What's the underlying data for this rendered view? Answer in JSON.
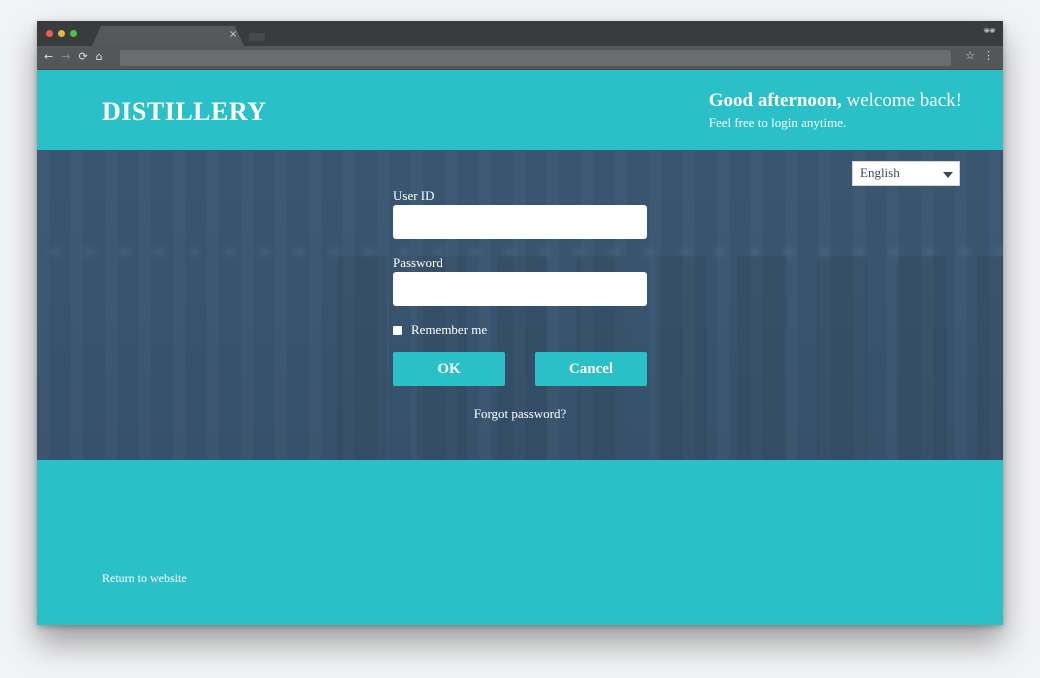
{
  "browser": {
    "tab_close": "×",
    "incognito_icon": "🕶",
    "nav_back": "←",
    "nav_forward": "→",
    "nav_reload": "⟳",
    "nav_home": "⌂",
    "star_icon": "☆",
    "menu_icon": "⋮"
  },
  "header": {
    "logo": "DISTILLERY",
    "greeting_bold": "Good afternoon,",
    "greeting_rest": " welcome back!",
    "greeting_sub": "Feel free to login anytime."
  },
  "language": {
    "selected": "English"
  },
  "login": {
    "user_id_label": "User ID",
    "user_id_value": "",
    "password_label": "Password",
    "password_value": "",
    "remember_label": "Remember me",
    "ok_label": "OK",
    "cancel_label": "Cancel",
    "forgot_label": "Forgot password?"
  },
  "footer": {
    "return_link": "Return to website"
  },
  "colors": {
    "brand": "#2ac0c8",
    "hero_overlay": "#3b5773"
  }
}
